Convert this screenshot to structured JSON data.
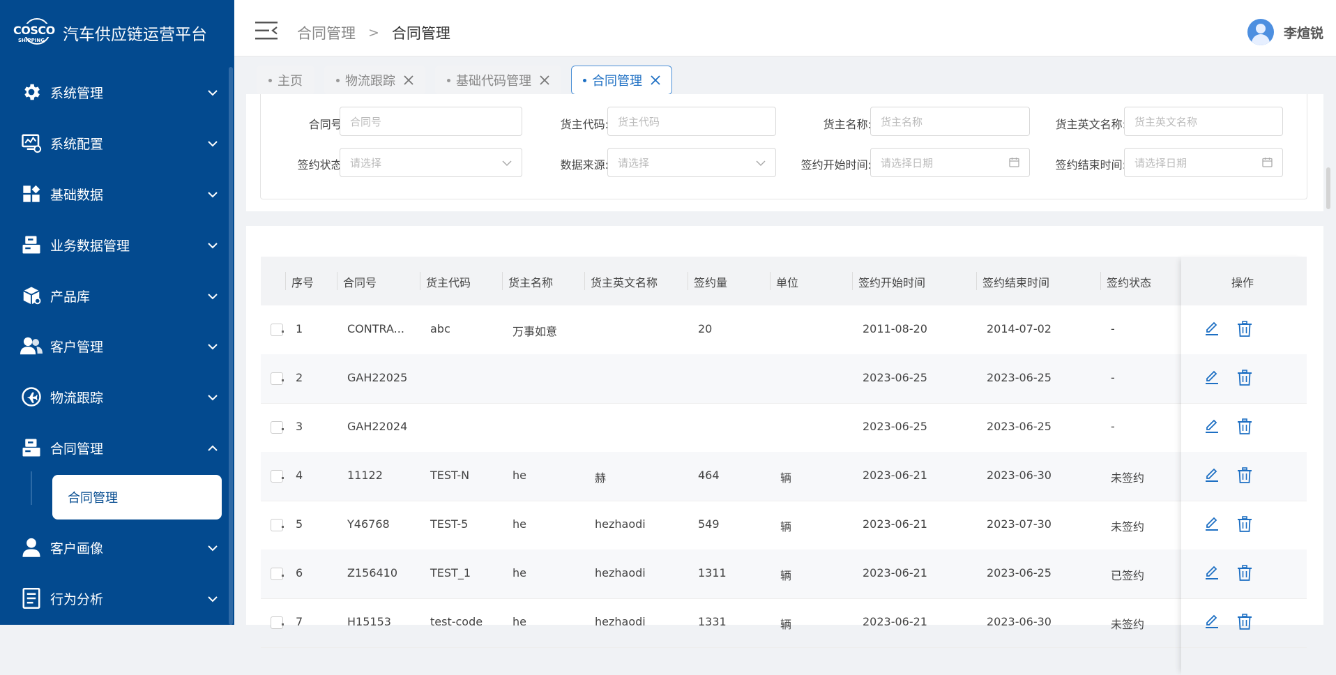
{
  "app": {
    "title": "汽车供应链运营平台",
    "logo_text": "COSCO",
    "logo_sub": "SHIPPING"
  },
  "sidebar": {
    "items": [
      {
        "label": "系统管理",
        "icon": "gear-icon"
      },
      {
        "label": "系统配置",
        "icon": "monitor-settings-icon"
      },
      {
        "label": "基础数据",
        "icon": "grid-icon"
      },
      {
        "label": "业务数据管理",
        "icon": "database-icon"
      },
      {
        "label": "产品库",
        "icon": "cube-icon"
      },
      {
        "label": "客户管理",
        "icon": "users-icon"
      },
      {
        "label": "物流跟踪",
        "icon": "plane-icon"
      },
      {
        "label": "合同管理",
        "icon": "contract-icon"
      },
      {
        "label": "客户画像",
        "icon": "user-icon"
      },
      {
        "label": "行为分析",
        "icon": "document-list-icon"
      }
    ],
    "active_sub": "合同管理"
  },
  "header": {
    "breadcrumb": [
      "合同管理",
      "合同管理"
    ],
    "separator": ">",
    "user": "李煊锐"
  },
  "tabs": [
    {
      "label": "主页",
      "closable": false
    },
    {
      "label": "物流跟踪",
      "closable": true
    },
    {
      "label": "基础代码管理",
      "closable": true
    },
    {
      "label": "合同管理",
      "closable": true,
      "active": true
    }
  ],
  "filters": {
    "contract_no": {
      "label": "合同号:",
      "placeholder": "合同号"
    },
    "owner_code": {
      "label": "货主代码:",
      "placeholder": "货主代码"
    },
    "owner_name": {
      "label": "货主名称:",
      "placeholder": "货主名称"
    },
    "owner_en_name": {
      "label": "货主英文名称:",
      "placeholder": "货主英文名称"
    },
    "sign_status": {
      "label": "签约状态:",
      "placeholder": "请选择"
    },
    "data_source": {
      "label": "数据来源:",
      "placeholder": "请选择"
    },
    "sign_start": {
      "label": "签约开始时间:",
      "placeholder": "请选择日期"
    },
    "sign_end": {
      "label": "签约结束时间:",
      "placeholder": "请选择日期"
    }
  },
  "table": {
    "columns": [
      "序号",
      "合同号",
      "货主代码",
      "货主名称",
      "货主英文名称",
      "签约量",
      "单位",
      "签约开始时间",
      "签约结束时间",
      "签约状态",
      "操作"
    ],
    "rows": [
      {
        "idx": "1",
        "contract": "CONTRA...",
        "code": "abc",
        "name": "万事如意",
        "en": "",
        "qty": "20",
        "unit": "",
        "start": "2011-08-20",
        "end": "2014-07-02",
        "status": "-"
      },
      {
        "idx": "2",
        "contract": "GAH22025",
        "code": "",
        "name": "",
        "en": "",
        "qty": "",
        "unit": "",
        "start": "2023-06-25",
        "end": "2023-06-25",
        "status": "-"
      },
      {
        "idx": "3",
        "contract": "GAH22024",
        "code": "",
        "name": "",
        "en": "",
        "qty": "",
        "unit": "",
        "start": "2023-06-25",
        "end": "2023-06-25",
        "status": "-"
      },
      {
        "idx": "4",
        "contract": "11122",
        "code": "TEST-N",
        "name": "he",
        "en": "赫",
        "qty": "464",
        "unit": "辆",
        "start": "2023-06-21",
        "end": "2023-06-30",
        "status": "未签约"
      },
      {
        "idx": "5",
        "contract": "Y46768",
        "code": "TEST-5",
        "name": "he",
        "en": "hezhaodi",
        "qty": "549",
        "unit": "辆",
        "start": "2023-06-21",
        "end": "2023-07-30",
        "status": "未签约"
      },
      {
        "idx": "6",
        "contract": "Z156410",
        "code": "TEST_1",
        "name": "he",
        "en": "hezhaodi",
        "qty": "1311",
        "unit": "辆",
        "start": "2023-06-21",
        "end": "2023-06-25",
        "status": "已签约"
      },
      {
        "idx": "7",
        "contract": "H15153",
        "code": "test-code",
        "name": "he",
        "en": "hezhaodi",
        "qty": "1331",
        "unit": "辆",
        "start": "2023-06-21",
        "end": "2023-06-30",
        "status": "未签约"
      }
    ]
  },
  "colors": {
    "sidebar": "#034a8f",
    "accent": "#1d6fc3"
  }
}
